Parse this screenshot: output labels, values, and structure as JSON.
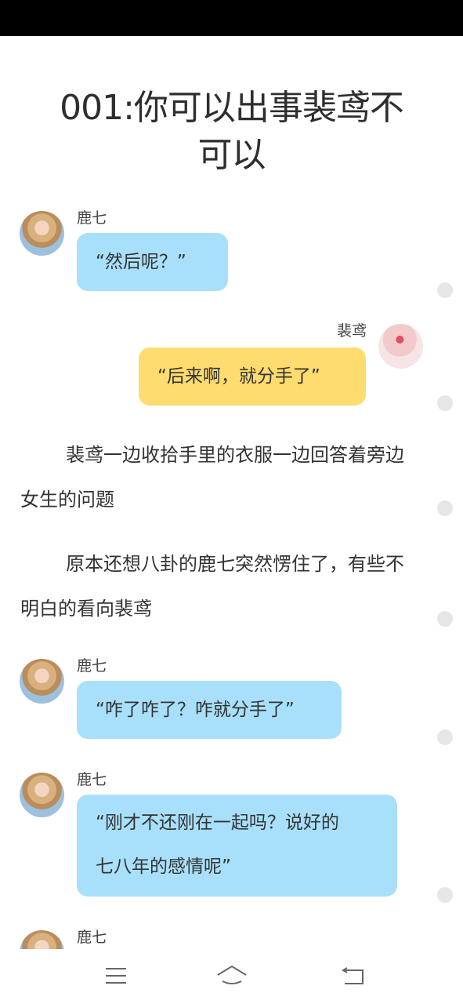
{
  "chapter": {
    "title_line1": "001:你可以出事裴鸢不",
    "title_line2": "可以"
  },
  "messages": [
    {
      "sender": "鹿七",
      "text": "“然后呢？”",
      "side": "left",
      "color": "#a8e0fb",
      "avatar": "avatar-luqi"
    },
    {
      "sender": "裴鸢",
      "text": "“后来啊，就分手了”",
      "side": "right",
      "color": "#fedc6f",
      "avatar": "avatar-peiyuan"
    },
    {
      "sender": "鹿七",
      "text": "“咋了咋了？咋就分手了”",
      "side": "left",
      "color": "#a8e0fb",
      "avatar": "avatar-luqi"
    },
    {
      "sender": "鹿七",
      "text_line1": "“刚才不还刚在一起吗？说好的",
      "text_line2": "七八年的感情呢”",
      "side": "left",
      "color": "#a8e0fb",
      "avatar": "avatar-luqi"
    },
    {
      "sender": "鹿七",
      "side": "left",
      "avatar": "avatar-luqi"
    }
  ],
  "paragraphs": [
    "裴鸢一边收拾手里的衣服一边回答着旁边女生的问题",
    "原本还想八卦的鹿七突然愣住了，有些不明白的看向裴鸢"
  ],
  "nav": {
    "menu": "menu-icon",
    "home": "home-icon",
    "back": "back-icon"
  }
}
